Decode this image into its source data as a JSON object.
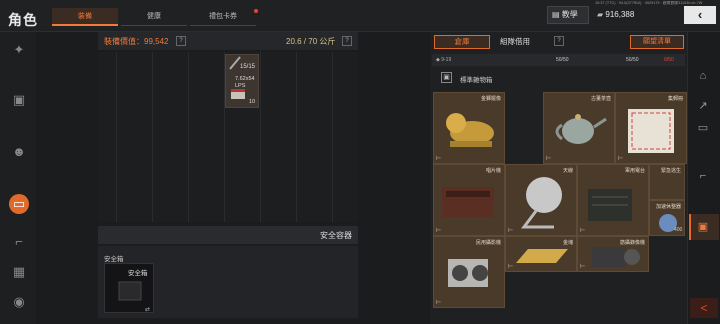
{
  "header": {
    "title": "角色",
    "tabs": [
      {
        "label": "裝備",
        "active": true
      },
      {
        "label": "健康",
        "active": false
      },
      {
        "label": "禮包卡券",
        "active": false
      }
    ],
    "teach_label": "教學",
    "system_line": "15:37 (TTC) · 94.0(377ff10) · 4929179 · 越南數據311530.ch.7W",
    "money": "916,388",
    "back_icon": "‹"
  },
  "sidebar": {
    "icons": [
      "gun-icon",
      "vest-icon",
      "face-icon",
      "bag-icon",
      "pistol-icon",
      "gift-icon",
      "coin-icon"
    ]
  },
  "equipment": {
    "value_label": "裝備價值：",
    "value": "99,542",
    "weight": "20.6 / 70 公斤",
    "help": "?",
    "ammo": {
      "count": "15/15",
      "name": "7.62x54 LPS",
      "qty": "10"
    }
  },
  "safe": {
    "header": "安全容器",
    "label": "安全箱",
    "item_label": "安全箱"
  },
  "warehouse": {
    "tab_warehouse": "倉庫",
    "tab_team": "組隊借用",
    "wishlist": "願望清單",
    "range": "9-19",
    "capacity_1": "50/50",
    "capacity_2": "50/50",
    "capacity_3": "0/50",
    "category": "標準雜物箱",
    "items": [
      {
        "label": "金獅擺像"
      },
      {
        "label": "古董茶壺"
      },
      {
        "label": "集郵冊"
      },
      {
        "label": "唱片機"
      },
      {
        "label": "天線"
      },
      {
        "label": "軍用電台"
      },
      {
        "label": "緊急逃生"
      },
      {
        "label": "加速休整器"
      },
      {
        "label": "民用攝影機"
      },
      {
        "label": "金塊"
      },
      {
        "label": "筋攝錄像機"
      }
    ],
    "item_count": "400"
  },
  "right_nav": {
    "icons": [
      "home-icon",
      "weapon-icon",
      "id-card-icon",
      "rifle-icon",
      "box-icon"
    ],
    "collapse": "<"
  },
  "colors": {
    "accent": "#e06a2a",
    "alert": "#e8442e"
  }
}
